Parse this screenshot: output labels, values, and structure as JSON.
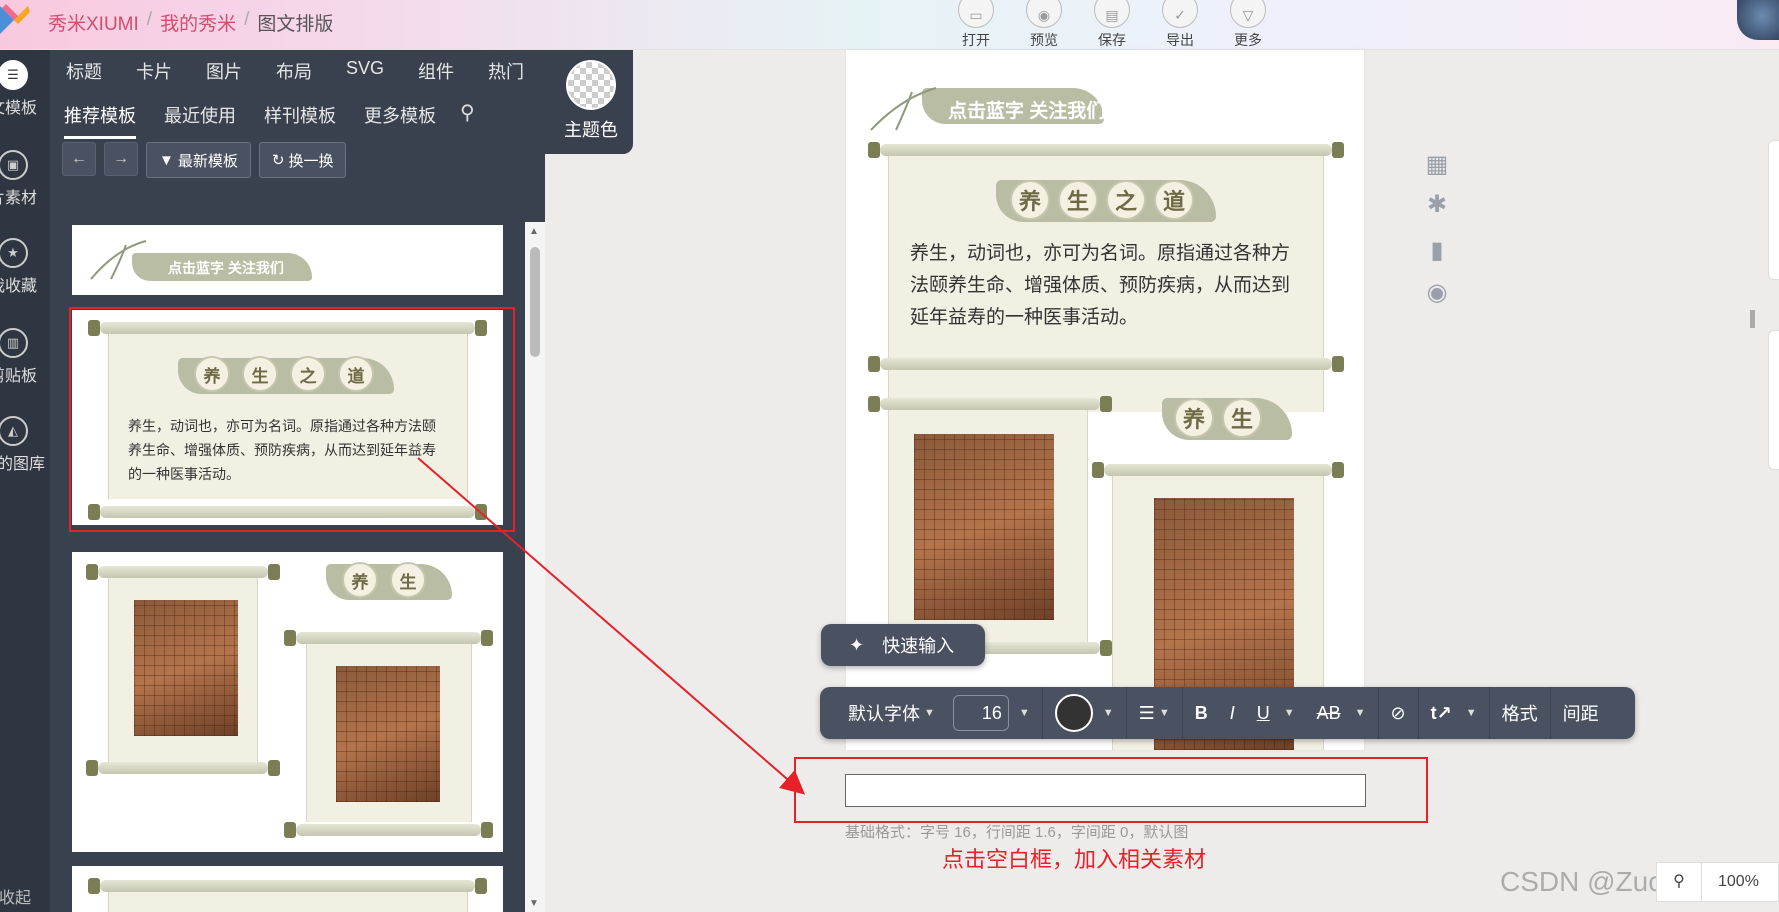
{
  "breadcrumb": {
    "brand": "秀米XIUMI",
    "sep": "/",
    "my": "我的秀米",
    "current": "图文排版"
  },
  "toolbar_top": [
    {
      "label": "打开",
      "icon": "folder-icon"
    },
    {
      "label": "预览",
      "icon": "preview-icon"
    },
    {
      "label": "保存",
      "icon": "save-icon"
    },
    {
      "label": "导出",
      "icon": "export-icon"
    },
    {
      "label": "更多",
      "icon": "more-icon"
    }
  ],
  "rail": [
    {
      "label": "文模板",
      "icon": "list-icon"
    },
    {
      "label": "片素材",
      "icon": "image-icon"
    },
    {
      "label": "我收藏",
      "icon": "favorite-icon"
    },
    {
      "label": "剪贴板",
      "icon": "clipboard-icon"
    },
    {
      "label": "我的图库",
      "icon": "gallery-icon"
    }
  ],
  "rail_collapse": "收起",
  "tabs_primary": [
    "标题",
    "卡片",
    "图片",
    "布局",
    "SVG",
    "组件",
    "热门"
  ],
  "tabs_secondary": [
    "推荐模板",
    "最近使用",
    "样刊模板",
    "更多模板"
  ],
  "theme_label": "主题色",
  "buttons": {
    "latest": "最新模板",
    "shuffle": "换一换"
  },
  "template": {
    "banner": "点击蓝字 关注我们",
    "title_chars": [
      "养",
      "生",
      "之",
      "道"
    ],
    "body": "养生，动词也，亦可为名词。原指通过各种方法颐养生命、增强体质、预防疾病，从而达到延年益寿的一种医事活动。",
    "sub_title_chars": [
      "养",
      "生"
    ]
  },
  "quick_input": "快速输入",
  "format_bar": {
    "font": "默认字体",
    "size": "16",
    "bold": "B",
    "italic": "I",
    "underline": "U",
    "case": "AB",
    "format": "格式",
    "spacing": "间距"
  },
  "base_format": "基础格式：字号 16，行间距 1.6，字间距 0，默认图",
  "hint": "点击空白框，加入相关素材",
  "zoom": "100%",
  "watermark": "CSDN @Zucker.N"
}
